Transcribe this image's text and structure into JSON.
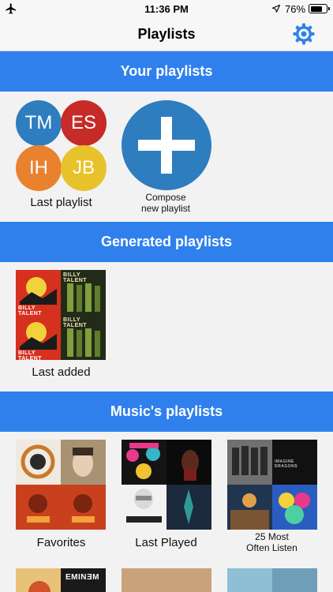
{
  "status_bar": {
    "time": "11:36 PM",
    "battery_pct": "76%",
    "battery_level": 0.76
  },
  "nav": {
    "title": "Playlists"
  },
  "sections": {
    "your": "Your playlists",
    "generated": "Generated playlists",
    "music": "Music's playlists"
  },
  "your_playlists": {
    "last_playlist": {
      "label": "Last playlist",
      "avatars": [
        "TM",
        "ES",
        "IH",
        "JB"
      ]
    },
    "compose": {
      "line1": "Compose",
      "line2": "new playlist"
    }
  },
  "generated_playlists": [
    {
      "label": "Last added",
      "album_text": "BILLY TALENT"
    }
  ],
  "music_playlists": [
    {
      "label": "Favorites"
    },
    {
      "label": "Last Played"
    },
    {
      "label_line1": "25 Most",
      "label_line2": "Often Listen",
      "album_text": "IMAGINE DRAGONS"
    }
  ],
  "colors": {
    "accent": "#2f80ed",
    "avatar_tm": "#2e7dbf",
    "avatar_es": "#c62b27",
    "avatar_ih": "#e8822f",
    "avatar_jb": "#e8c22b"
  }
}
